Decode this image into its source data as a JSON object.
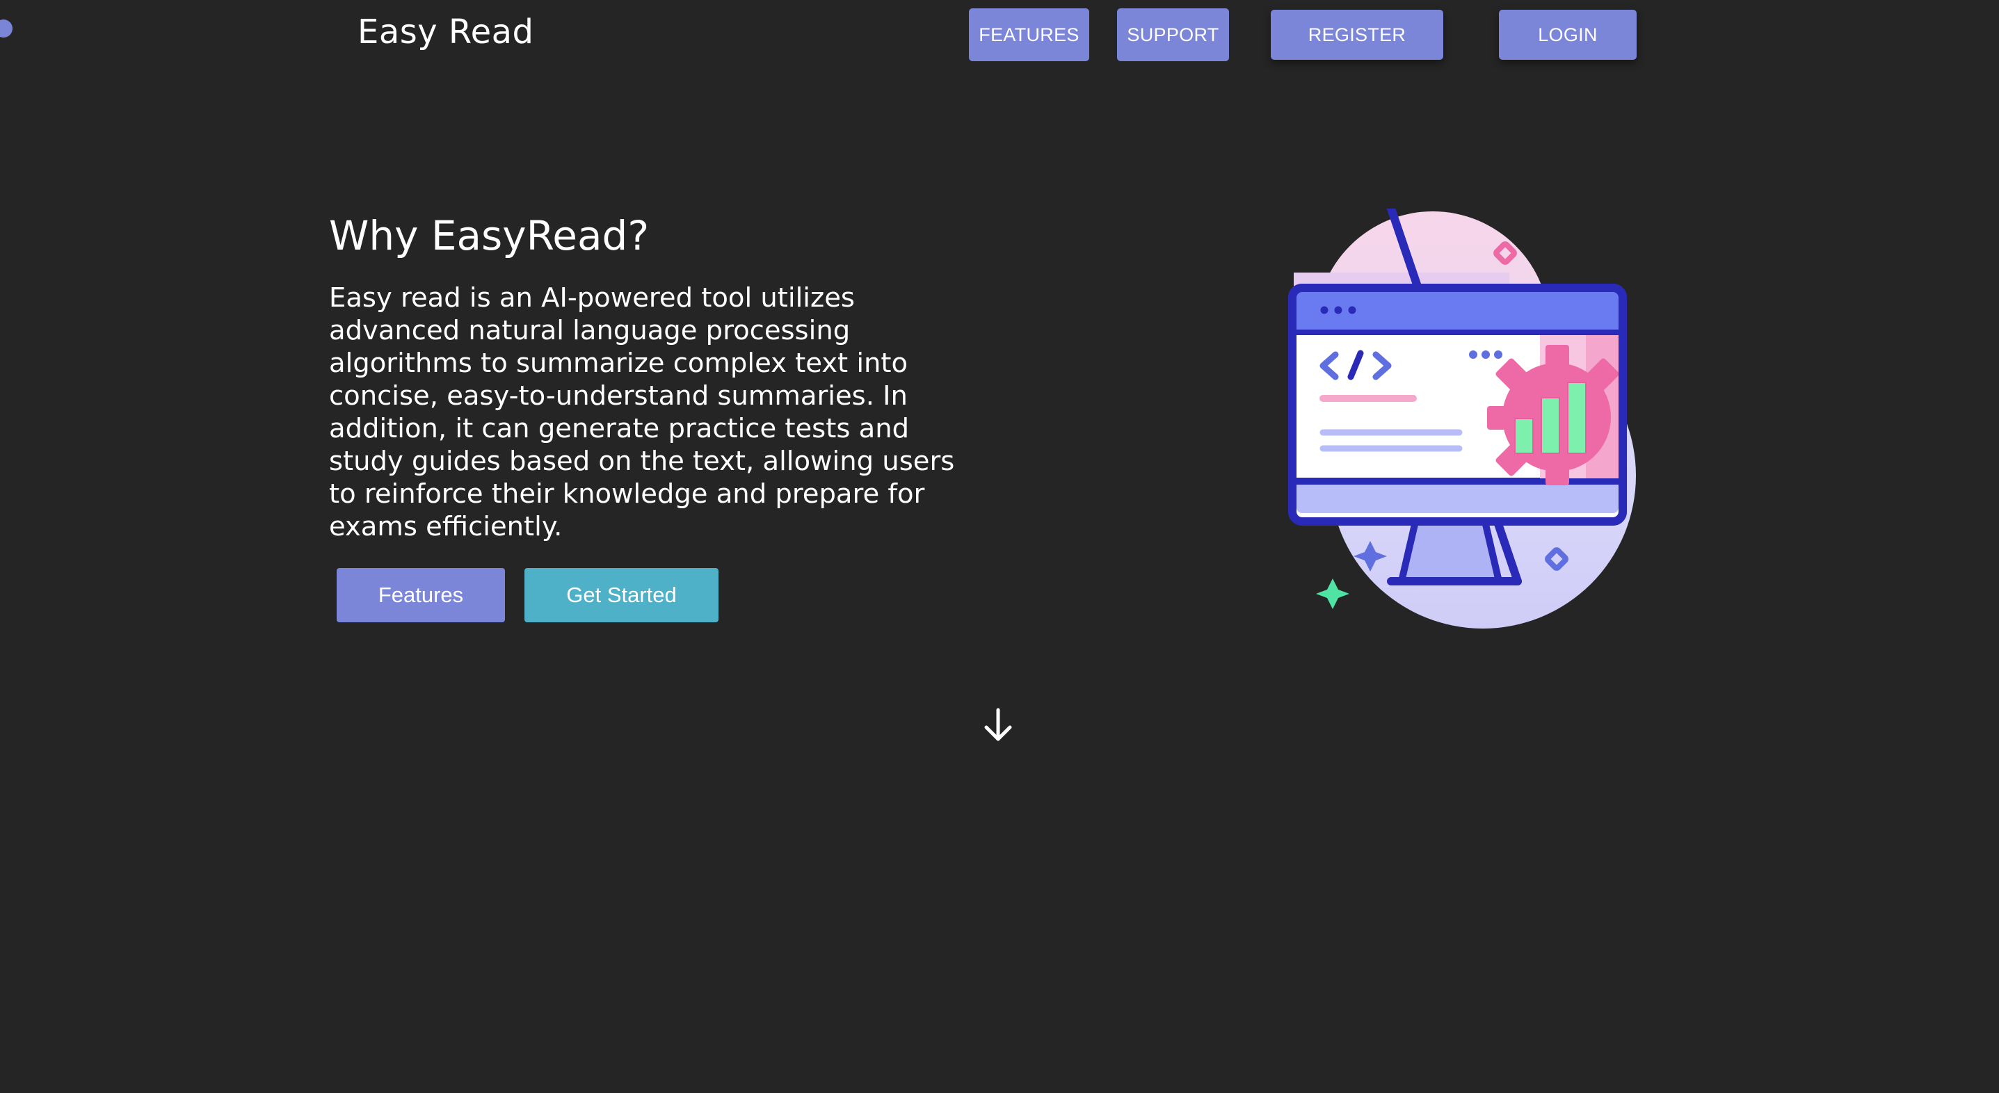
{
  "header": {
    "brand": "Easy Read",
    "nav": {
      "features": "FEATURES",
      "support": "SUPPORT",
      "register": "REGISTER",
      "login": "LOGIN"
    }
  },
  "hero": {
    "title": "Why EasyRead?",
    "description": "Easy read is an AI-powered tool utilizes advanced natural language processing algorithms to summarize complex text into concise, easy-to-understand summaries. In addition, it can generate practice tests and study guides based on the text, allowing users to reinforce their knowledge and prepare for exams efficiently.",
    "buttons": {
      "features": "Features",
      "get_started": "Get Started"
    }
  },
  "icons": {
    "scroll": "arrow-down-icon",
    "illustration": "computer-monitor-analytics-icon"
  },
  "colors": {
    "background": "#252525",
    "primary": "#7c86d9",
    "accent": "#4eb1c8",
    "text": "#ffffff"
  }
}
